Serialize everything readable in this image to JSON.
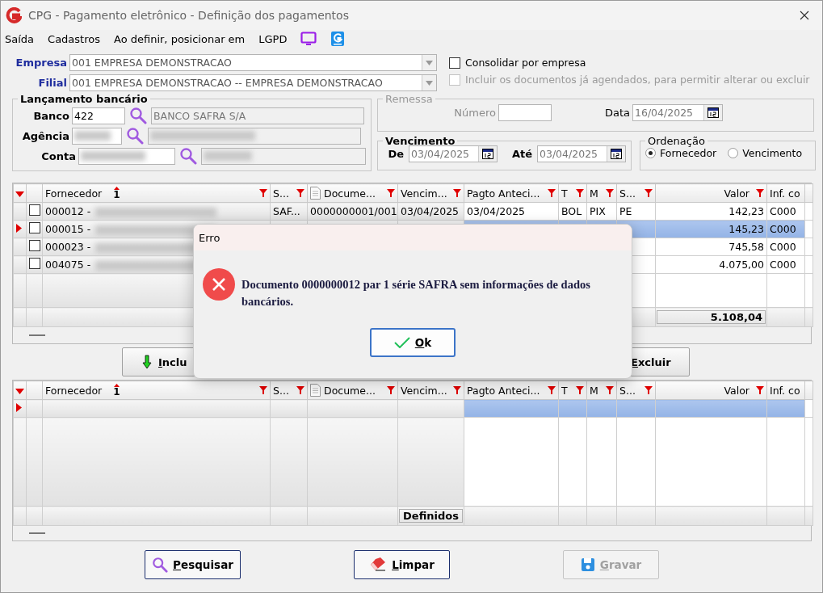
{
  "window": {
    "title": "CPG - Pagamento eletrônico - Definição dos pagamentos"
  },
  "menu": [
    {
      "label": "Saída"
    },
    {
      "label": "Cadastros"
    },
    {
      "label": "Ao definir, posicionar em"
    },
    {
      "label": "LGPD"
    }
  ],
  "company": [
    {
      "label": "Empresa",
      "value": "001 EMPRESA DEMONSTRACAO"
    },
    {
      "label": "Filial",
      "value": "001 EMPRESA DEMONSTRACAO -- EMPRESA DEMONSTRACAO"
    }
  ],
  "options": [
    {
      "label": "Consolidar por empresa",
      "checked": false,
      "disabled": false
    },
    {
      "label": "Incluir os documentos já agendados, para permitir alterar ou excluir",
      "checked": false,
      "disabled": true
    }
  ],
  "bank": {
    "title": "Lançamento bancário",
    "fields": [
      {
        "label": "Banco",
        "code": "422",
        "name": "BANCO SAFRA S/A",
        "redacted": false
      },
      {
        "label": "Agência",
        "redacted": true
      },
      {
        "label": "Conta",
        "redacted": true
      }
    ]
  },
  "remessa": {
    "title": "Remessa",
    "disabled": true,
    "number_label": "Número",
    "date_label": "Data",
    "date": "16/04/2025"
  },
  "vencimento": {
    "title": "Vencimento",
    "from_label": "De",
    "from": "03/04/2025",
    "to_label": "Até",
    "to": "03/04/2025"
  },
  "ordering": {
    "title": "Ordenação",
    "options": [
      {
        "label": "Fornecedor",
        "selected": true
      },
      {
        "label": "Vencimento",
        "selected": false
      }
    ]
  },
  "grid": {
    "columns": [
      {
        "label": "Fornecedor",
        "sort": "1",
        "kind": "text"
      },
      {
        "label": "S...",
        "kind": "text"
      },
      {
        "label": "Docume...",
        "kind": "text"
      },
      {
        "label": "Vencim...",
        "kind": "text"
      },
      {
        "label": "Pagto Anteci...",
        "kind": "text"
      },
      {
        "label": "T",
        "kind": "text"
      },
      {
        "label": "M",
        "kind": "text"
      },
      {
        "label": "S...",
        "kind": "text"
      },
      {
        "label": "Valor",
        "kind": "number"
      },
      {
        "label": "Inf. co",
        "kind": "cut"
      }
    ],
    "rows": [
      {
        "selected": false,
        "checked": false,
        "cells": [
          "000012 -",
          "SAF...",
          "0000000001/001",
          "03/04/2025",
          "03/04/2025",
          "BOL",
          "PIX",
          "PE",
          "142,23",
          "C000"
        ]
      },
      {
        "selected": true,
        "checked": false,
        "cells": [
          "000015 -",
          null,
          null,
          null,
          null,
          null,
          null,
          null,
          "145,23",
          "C000"
        ]
      },
      {
        "selected": false,
        "checked": false,
        "cells": [
          "000023 -",
          null,
          null,
          null,
          null,
          null,
          null,
          null,
          "745,58",
          "C000"
        ]
      },
      {
        "selected": false,
        "checked": false,
        "cells": [
          "004075 -",
          null,
          null,
          null,
          null,
          null,
          null,
          null,
          "4.075,00",
          "C000"
        ]
      }
    ],
    "total": "5.108,04"
  },
  "grid_buttons": [
    {
      "label": "Inclu",
      "kind": "include"
    },
    {
      "label": "Excluir",
      "kind": "plain"
    }
  ],
  "defined_grid": {
    "columns": [
      {
        "label": "Fornecedor",
        "sort": "1",
        "kind": "text"
      },
      {
        "label": "S...",
        "kind": "text"
      },
      {
        "label": "Docume...",
        "kind": "text"
      },
      {
        "label": "Vencim...",
        "kind": "text"
      },
      {
        "label": "Pagto Anteci...",
        "kind": "text"
      },
      {
        "label": "T",
        "kind": "text"
      },
      {
        "label": "M",
        "kind": "text"
      },
      {
        "label": "S...",
        "kind": "text"
      },
      {
        "label": "Valor",
        "kind": "number"
      },
      {
        "label": "Inf. co",
        "kind": "cut"
      }
    ],
    "rows": [
      {
        "selected": true
      }
    ],
    "footer": "Definidos"
  },
  "actions": [
    {
      "label": "Pesquisar",
      "kind": "search",
      "disabled": false
    },
    {
      "label": "Limpar",
      "kind": "eraser",
      "disabled": false
    },
    {
      "label": "Gravar",
      "kind": "save",
      "disabled": true
    }
  ],
  "dialog": {
    "title": "Erro",
    "message": "Documento 0000000012 par 1 série SAFRA sem informações de dados bancários.",
    "button": "Ok"
  }
}
